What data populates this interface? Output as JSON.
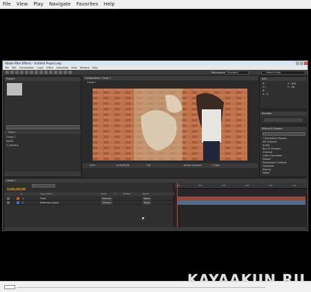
{
  "outer_menu": [
    "File",
    "View",
    "Play",
    "Navigate",
    "Favorites",
    "Help"
  ],
  "app": {
    "title": "Adobe After Effects - Untitled Project.aep",
    "menu": [
      "File",
      "Edit",
      "Composition",
      "Layer",
      "Effect",
      "Animation",
      "View",
      "Window",
      "Help"
    ],
    "workspace_label": "Workspace:",
    "workspace_value": "Standard",
    "search_help": "Search Help"
  },
  "project": {
    "tab": "Project",
    "column": "Name",
    "items": [
      "Comp 1",
      "Solids",
      "7_Hammy"
    ]
  },
  "viewer": {
    "tab": "Composition: Comp 1",
    "subtab": "Comp 1",
    "zoom": "50%",
    "timecode": "0;00;00;00",
    "resolution": "Full",
    "view": "Active Camera",
    "views": "1 View"
  },
  "info": {
    "tab": "Info",
    "r": "R :",
    "g": "G :",
    "b": "B :",
    "a": "A : 0",
    "x": "X : 826",
    "y": "Y : 98"
  },
  "preview": {
    "tab": "Preview"
  },
  "effects": {
    "tab": "Effects & Presets",
    "items": [
      "* Animation Presets",
      "3D Channel",
      "Audio",
      "Blur & Sharpen",
      "Channel",
      "Color Correction",
      "Distort",
      "Expression Controls",
      "Generate",
      "Keying",
      "Matte",
      "Noise & Grain"
    ]
  },
  "timeline": {
    "tab": "Comp 1",
    "timecode": "0;00;00;00",
    "columns": [
      "#",
      "Layer Name",
      "Mode",
      "T",
      "TrkMat",
      "Parent"
    ],
    "layers": [
      {
        "num": "1",
        "name": "Fluid",
        "mode": "Normal",
        "parent": "None",
        "color": "#d2542f"
      },
      {
        "num": "2",
        "name": "[Hammy Layer]",
        "mode": "Normal",
        "parent": "None",
        "color": "#3d6fd0"
      }
    ],
    "ruler": [
      "0s",
      "02s",
      "04s",
      "06s",
      "08s",
      "10s"
    ]
  },
  "watermark": "KAYAAKUN.RU"
}
